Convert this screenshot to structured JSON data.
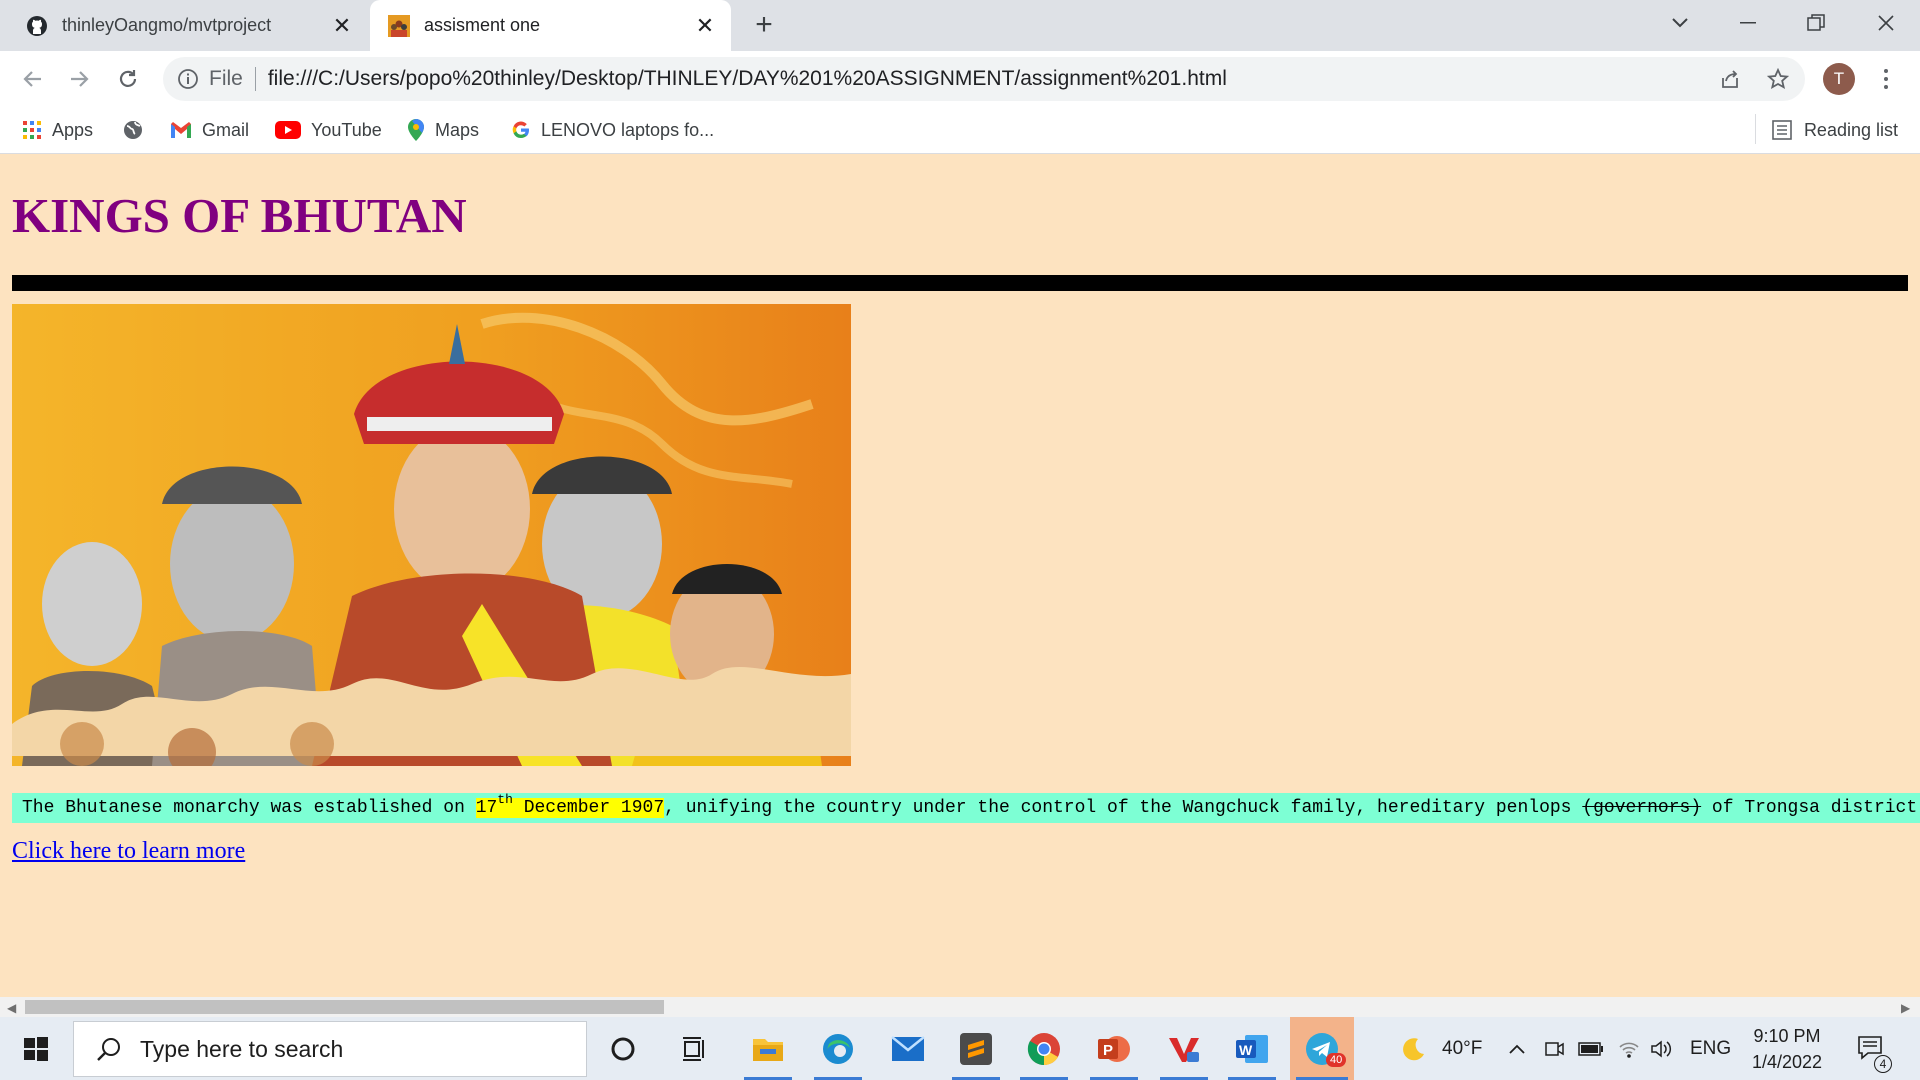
{
  "browser": {
    "tabs": [
      {
        "title": "thinleyOangmo/mvtproject",
        "favicon": "github-icon"
      },
      {
        "title": "assisment one",
        "favicon": "kings-thumbnail-icon"
      }
    ],
    "address_scheme_label": "File",
    "address_url": "file:///C:/Users/popo%20thinley/Desktop/THINLEY/DAY%201%20ASSIGNMENT/assignment%201.html",
    "profile_initial": "T",
    "bookmarks": [
      {
        "label": "Apps",
        "icon": "apps-grid-icon"
      },
      {
        "label": "",
        "icon": "globe-icon"
      },
      {
        "label": "Gmail",
        "icon": "gmail-icon"
      },
      {
        "label": "YouTube",
        "icon": "youtube-icon"
      },
      {
        "label": "Maps",
        "icon": "maps-icon"
      },
      {
        "label": "LENOVO laptops fo...",
        "icon": "google-icon"
      }
    ],
    "reading_list_label": "Reading list"
  },
  "page": {
    "heading": "KINGS OF BHUTAN",
    "paragraph": {
      "part1": "The Bhutanese monarchy was established on ",
      "highlight_day": "17",
      "highlight_sup": "th",
      "highlight_rest": " December 1907",
      "part2": ", unifying the country under the control of the Wangchuck family, hereditary penlops ",
      "struck": "(governors)",
      "part3": " of Trongsa district."
    },
    "link_text": "Click here to learn more",
    "colors": {
      "background": "#fde3c0",
      "heading": "#800080",
      "paragraph_bg": "#7dffd4",
      "highlight": "#ffff00",
      "link": "#0000ee"
    }
  },
  "taskbar": {
    "search_placeholder": "Type here to search",
    "weather": "40°F",
    "language": "ENG",
    "time": "9:10 PM",
    "date": "1/4/2022",
    "telegram_badge": "40",
    "notification_count": "4",
    "apps": [
      "cortana-icon",
      "task-view-icon",
      "file-explorer-icon",
      "edge-icon",
      "mail-icon",
      "sublime-text-icon",
      "chrome-icon",
      "powerpoint-icon",
      "vivaldi-icon",
      "word-icon",
      "telegram-icon"
    ]
  }
}
